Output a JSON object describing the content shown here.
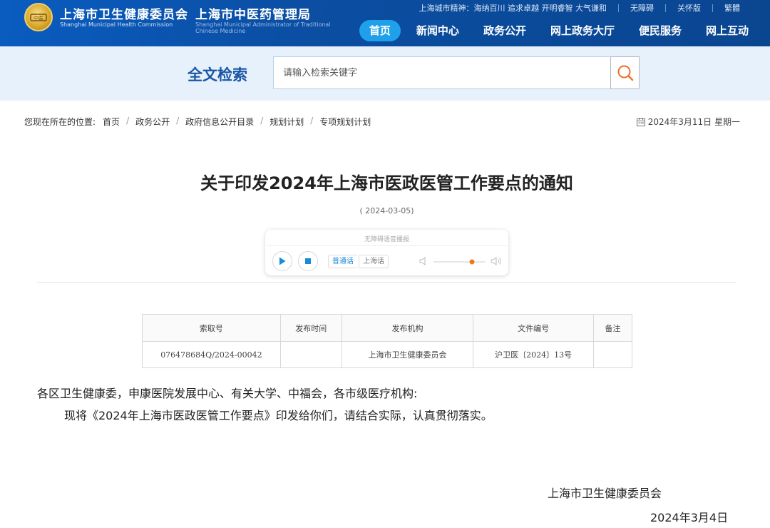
{
  "header": {
    "title_main": "上海市卫生健康委员会",
    "subtitle_main": "Shanghai Municipal Health Commission",
    "title_second": "上海市中医药管理局",
    "subtitle_second": "Shanghai Municipal Administrator of Traditional Chinese Medicine",
    "emblem_text": "中医",
    "top_links": [
      "上海城市精神：海纳百川 追求卓越 开明睿智 大气谦和",
      "无障碍",
      "关怀版",
      "繁體"
    ],
    "nav": [
      "首页",
      "新闻中心",
      "政务公开",
      "网上政务大厅",
      "便民服务",
      "网上互动"
    ],
    "nav_active": 0,
    "colors": {
      "header_bg": "#0b4ea2",
      "nav_active_bg": "#1fa0ea",
      "emblem_gold": "#d9a92e"
    }
  },
  "search": {
    "label": "全文检索",
    "placeholder": "请输入检索关键字",
    "button_icon": "search-icon",
    "accent": "#e8722a"
  },
  "breadcrumb": {
    "lead": "您现在所在的位置:",
    "items": [
      "首页",
      "政务公开",
      "政府信息公开目录",
      "规划计划",
      "专项规划计划"
    ],
    "separator": "/"
  },
  "date_display": "2024年3月11日 星期一",
  "article": {
    "title": "关于印发2024年上海市医政医管工作要点的通知",
    "pub_date": "( 2024-03-05)",
    "player": {
      "title": "无障碍语音播报",
      "lang_options": [
        "普通话",
        "上海话"
      ],
      "lang_selected": "普通话",
      "volume_fraction": 0.75,
      "play_icon": "play-icon",
      "stop_icon": "stop-icon"
    },
    "meta_table": {
      "headers": [
        "索取号",
        "发布时间",
        "发布机构",
        "文件编号",
        "备注"
      ],
      "rows": [
        [
          "076478684Q/2024-00042",
          "",
          "上海市卫生健康委员会",
          "沪卫医〔2024〕13号",
          ""
        ]
      ]
    },
    "para1": "各区卫生健康委，申康医院发展中心、有关大学、中福会，各市级医疗机构:",
    "para2": "现将《2024年上海市医政医管工作要点》印发给你们，请结合实际，认真贯彻落实。",
    "signature_org": "上海市卫生健康委员会",
    "signature_date": "2024年3月4日"
  }
}
